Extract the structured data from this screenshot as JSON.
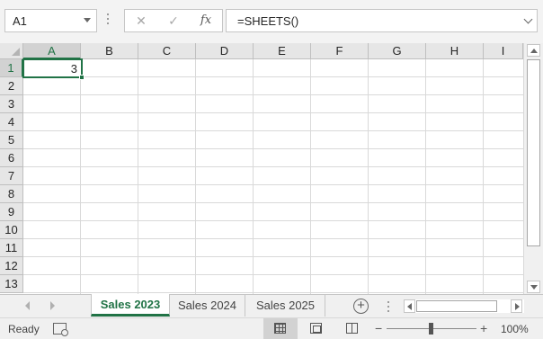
{
  "formula_bar": {
    "name_box": "A1",
    "cancel_glyph": "✕",
    "enter_glyph": "✓",
    "fx_glyph": "fx",
    "formula": "=SHEETS()"
  },
  "grid": {
    "columns": [
      "A",
      "B",
      "C",
      "D",
      "E",
      "F",
      "G",
      "H",
      "I"
    ],
    "rows": [
      "1",
      "2",
      "3",
      "4",
      "5",
      "6",
      "7",
      "8",
      "9",
      "10",
      "11",
      "12",
      "13"
    ],
    "active_cell": "A1",
    "active_cell_value": "3"
  },
  "tabs": [
    {
      "label": "Sales 2023",
      "active": true
    },
    {
      "label": "Sales 2024",
      "active": false
    },
    {
      "label": "Sales 2025",
      "active": false
    }
  ],
  "tab_bar": {
    "add_sheet_glyph": "+"
  },
  "status_bar": {
    "ready": "Ready",
    "zoom_minus": "−",
    "zoom_plus": "+",
    "zoom_level": "100%"
  },
  "colors": {
    "accent": "#217346",
    "header_bg": "#e6e6e6",
    "gridline": "#d9d9d9"
  }
}
